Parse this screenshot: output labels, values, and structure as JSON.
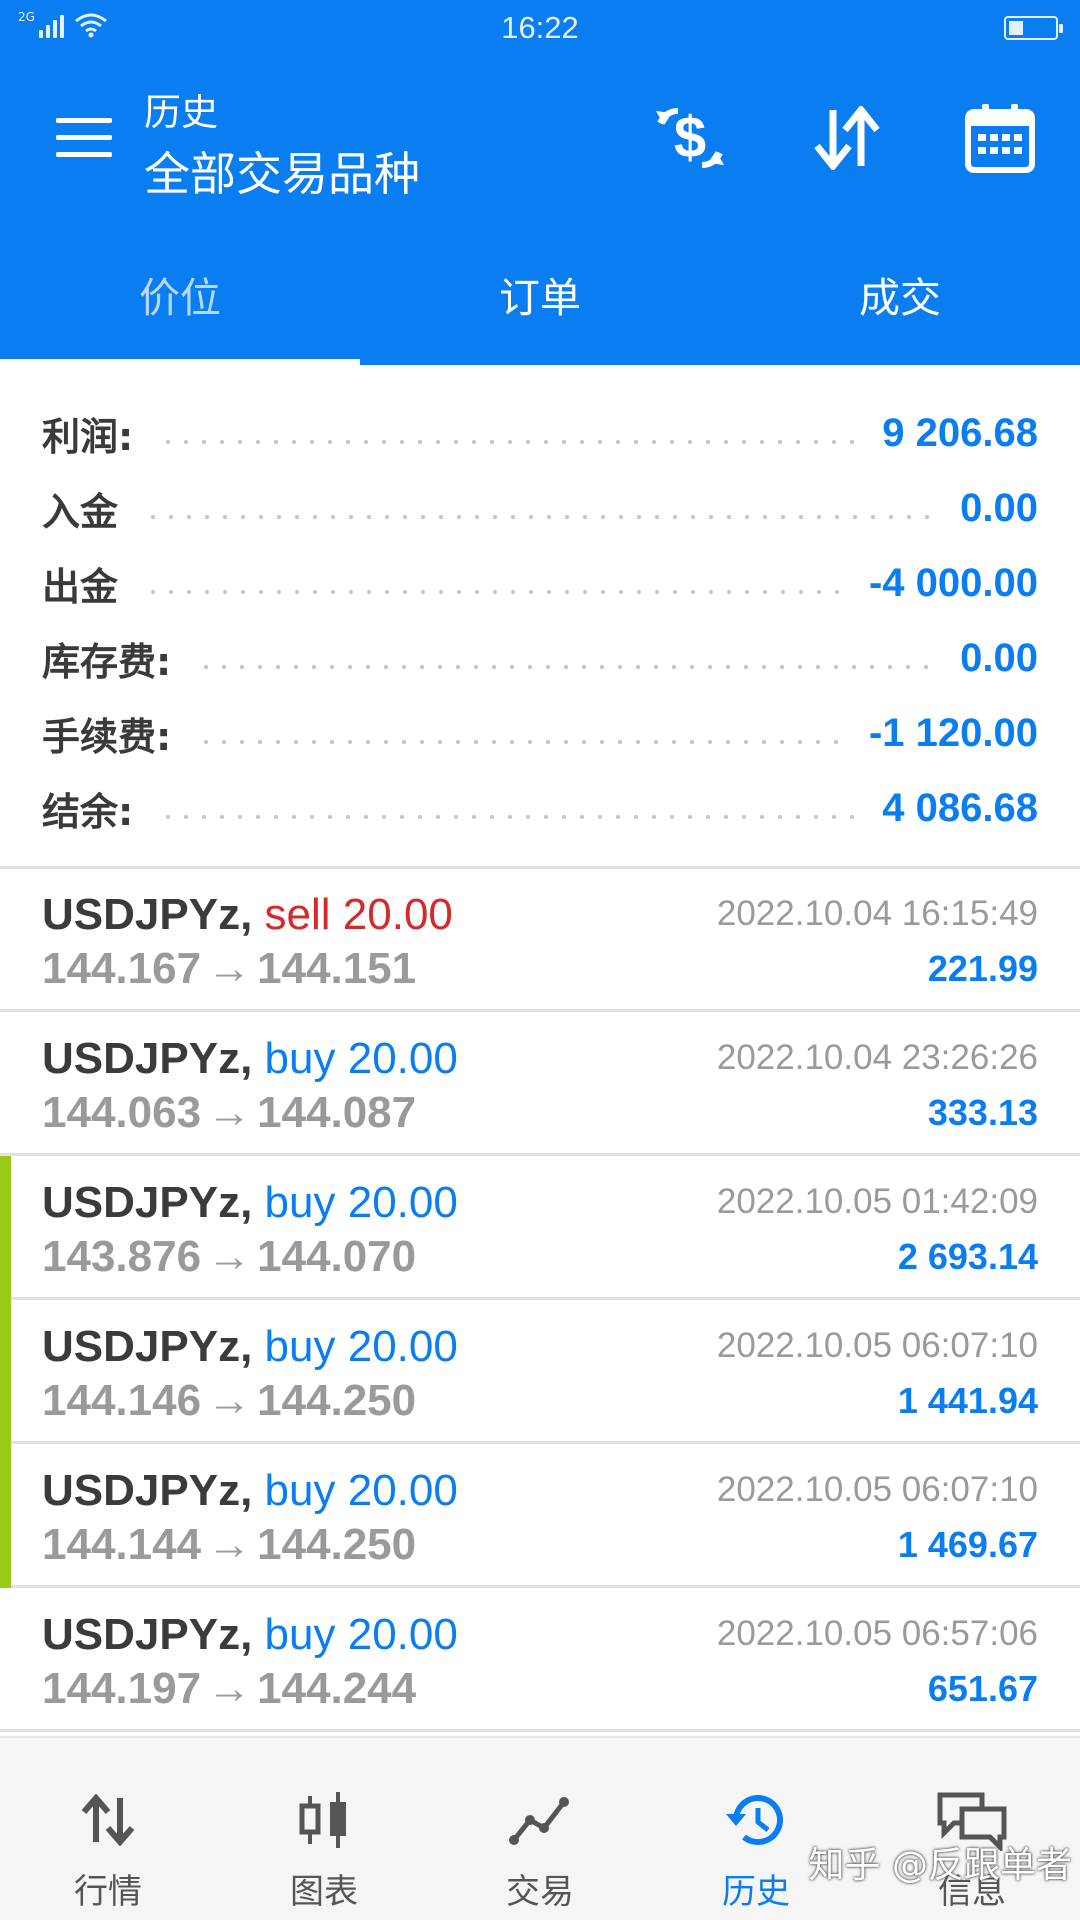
{
  "status_bar": {
    "network": "2G",
    "time": "16:22"
  },
  "header": {
    "title_small": "历史",
    "title_large": "全部交易品种"
  },
  "tabs": [
    {
      "label": "价位",
      "active": true
    },
    {
      "label": "订单",
      "active": false
    },
    {
      "label": "成交",
      "active": false
    }
  ],
  "summary": [
    {
      "label": "利润:",
      "value": "9 206.68"
    },
    {
      "label": "入金",
      "value": "0.00"
    },
    {
      "label": "出金",
      "value": "-4 000.00"
    },
    {
      "label": "库存费:",
      "value": "0.00"
    },
    {
      "label": "手续费:",
      "value": "-1 120.00"
    },
    {
      "label": "结余:",
      "value": "4 086.68"
    }
  ],
  "deals": [
    {
      "symbol": "USDJPYz,",
      "side": "sell",
      "volume": "20.00",
      "open": "144.167",
      "close": "144.151",
      "time": "2022.10.04 16:15:49",
      "profit": "221.99",
      "marked": false
    },
    {
      "symbol": "USDJPYz,",
      "side": "buy",
      "volume": "20.00",
      "open": "144.063",
      "close": "144.087",
      "time": "2022.10.04 23:26:26",
      "profit": "333.13",
      "marked": false
    },
    {
      "symbol": "USDJPYz,",
      "side": "buy",
      "volume": "20.00",
      "open": "143.876",
      "close": "144.070",
      "time": "2022.10.05 01:42:09",
      "profit": "2 693.14",
      "marked": true
    },
    {
      "symbol": "USDJPYz,",
      "side": "buy",
      "volume": "20.00",
      "open": "144.146",
      "close": "144.250",
      "time": "2022.10.05 06:07:10",
      "profit": "1 441.94",
      "marked": true
    },
    {
      "symbol": "USDJPYz,",
      "side": "buy",
      "volume": "20.00",
      "open": "144.144",
      "close": "144.250",
      "time": "2022.10.05 06:07:10",
      "profit": "1 469.67",
      "marked": true
    },
    {
      "symbol": "USDJPYz,",
      "side": "buy",
      "volume": "20.00",
      "open": "144.197",
      "close": "144.244",
      "time": "2022.10.05 06:57:06",
      "profit": "651.67",
      "marked": false
    }
  ],
  "arrow_symbol": "→",
  "bottom_nav": [
    {
      "label": "行情",
      "icon": "up-down-arrows-icon",
      "active": false
    },
    {
      "label": "图表",
      "icon": "candlestick-icon",
      "active": false
    },
    {
      "label": "交易",
      "icon": "trade-line-icon",
      "active": false
    },
    {
      "label": "历史",
      "icon": "history-clock-icon",
      "active": true
    },
    {
      "label": "信息",
      "icon": "chat-bubbles-icon",
      "active": false
    }
  ],
  "watermark": "知乎 @反跟单者",
  "colors": {
    "primary": "#0a7ef0",
    "sell": "#d42a2a",
    "marker": "#97cc1b",
    "muted": "#9a9a9a"
  }
}
